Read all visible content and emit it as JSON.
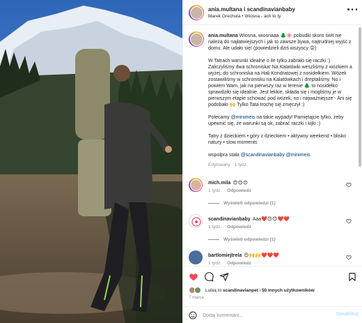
{
  "post": {
    "author": "anania.multana",
    "header_user": "ania.multana i scandinavianbaby",
    "header_sub": "Marek Grechuta • Wiosna - ach to ty",
    "caption": {
      "user": "ania.multana",
      "intro": "Wiosna, wiosnaaa 🌲🌸 pobudki skoro świt nie należą do najłatwiejszych i jak to zawsze bywa, najtrudniej wyjść z domu. Ale udało się! (powiedzieli dziś wszyscy 😜)",
      "p2": "W Tatrach warunki idealne o ile tylko zabrało się raczki :) Zaliczyliśmy dwa schroniska! Na Kalatówki weszliśmy z wózkiem a wyżej, do schroniska na Hali Kondratowej z nosidełkiem. Wózek zostawiliśmy w schronisku na Kalatówkach i dreptaliśmy. No i powiem Wam, jak na pierwszy raz w terenie 🌲 to nosidełko sprawdziło się idealnie. Jest lekkie, składa się i mogliśmy je w pierwszym etapie schować pod wózek, no i najważniejsze - Ani się podobało 🙌 Tylko Tata trochę się zmęczył :)",
      "p3_before": "Polecamy ",
      "p3_mention": "@minimeis",
      "p3_after": " na takie wypady! Pamiętajcie tylko, żeby upewnić się, że warunki są ok, zabrać raczki i kijki :)",
      "p4": "Tatry z dzieckiem • góry z dzieckiem • aktywny weekend • blisko natury • slow moments",
      "p5_before": "wspolpra stała ",
      "p5_mentions": "@scandinavianbaby @minimeis",
      "meta": "Edytowany · 1 tydz."
    },
    "comments": [
      {
        "user": "mich.mila",
        "text": "😍😍😍",
        "time": "1 tydz.",
        "reply": "Odpowiedz",
        "replies": "Wyświetl odpowiedzi (1)"
      },
      {
        "user": "scandinavianbaby",
        "text": "Aaa❤️😍😊❤️❤️",
        "time": "1 tydz.",
        "reply": "Odpowiedz",
        "replies": "Wyświetl odpowiedzi (1)"
      },
      {
        "user": "bartlomiejtrela",
        "text": "😍🙌🙌❤️❤️❤️",
        "time": "1 tydz.",
        "reply": "Odpowiedz",
        "replies": ""
      }
    ],
    "likes": {
      "prefix": "Lubią to ",
      "user": "scandinavianpet",
      "middle": " i ",
      "others": "50 innych użytkowników"
    },
    "date": "7 marca",
    "add_comment": {
      "placeholder": "Dodaj komentarz...",
      "post_label": "Opublikuj"
    },
    "icons": [
      "like-heart-icon",
      "comment-icon",
      "share-icon",
      "bookmark-icon",
      "emoji-icon",
      "more-options-icon"
    ],
    "colors": {
      "like_red": "#ed4956",
      "mention_blue": "#00376b",
      "post_disabled": "#b2dffc",
      "muted": "#8e8e8e"
    }
  }
}
